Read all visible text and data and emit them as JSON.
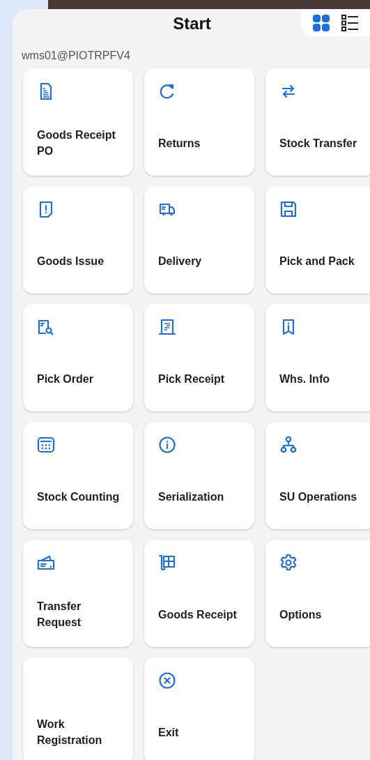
{
  "header": {
    "title": "Start",
    "view_toggle": [
      {
        "selected": true
      },
      {
        "selected": false
      }
    ]
  },
  "user": "wms01@PIOTRPFV4",
  "tiles": [
    {
      "label": "Goods Receipt PO"
    },
    {
      "label": "Returns"
    },
    {
      "label": "Stock Transfer"
    },
    {
      "label": "Goods Issue"
    },
    {
      "label": "Delivery"
    },
    {
      "label": "Pick and Pack"
    },
    {
      "label": "Pick Order"
    },
    {
      "label": "Pick Receipt"
    },
    {
      "label": "Whs. Info"
    },
    {
      "label": "Stock Counting"
    },
    {
      "label": "Serialization"
    },
    {
      "label": "SU Operations"
    },
    {
      "label": "Transfer Request"
    },
    {
      "label": "Goods Receipt"
    },
    {
      "label": "Options"
    },
    {
      "label": "Work Registration"
    },
    {
      "label": "Exit"
    }
  ]
}
